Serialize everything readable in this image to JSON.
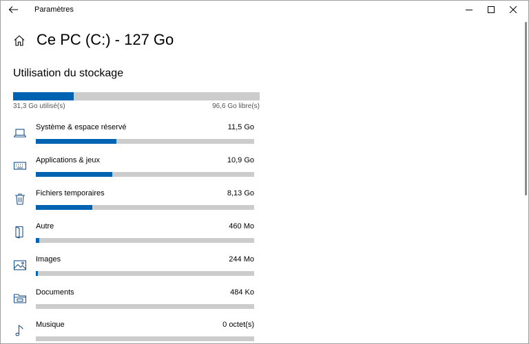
{
  "window": {
    "title": "Paramètres"
  },
  "header": {
    "title": "Ce PC (C:) - 127 Go"
  },
  "storage": {
    "section_title": "Utilisation du stockage",
    "used_fraction": 0.246,
    "used_label": "31,3 Go utilisé(s)",
    "free_label": "96,6 Go libre(s)"
  },
  "categories": [
    {
      "label": "Système & espace réservé",
      "size": "11,5 Go",
      "fraction": 0.37,
      "icon": "laptop-icon"
    },
    {
      "label": "Applications & jeux",
      "size": "10,9 Go",
      "fraction": 0.35,
      "icon": "keyboard-icon"
    },
    {
      "label": "Fichiers temporaires",
      "size": "8,13 Go",
      "fraction": 0.26,
      "icon": "trash-icon"
    },
    {
      "label": "Autre",
      "size": "460 Mo",
      "fraction": 0.015,
      "icon": "book-icon"
    },
    {
      "label": "Images",
      "size": "244 Mo",
      "fraction": 0.008,
      "icon": "image-icon"
    },
    {
      "label": "Documents",
      "size": "484 Ko",
      "fraction": 0.0,
      "icon": "folder-icon"
    },
    {
      "label": "Musique",
      "size": "0 octet(s)",
      "fraction": 0.0,
      "icon": "music-note-icon"
    }
  ],
  "colors": {
    "accent": "#0063b1",
    "track": "#cccccc"
  }
}
